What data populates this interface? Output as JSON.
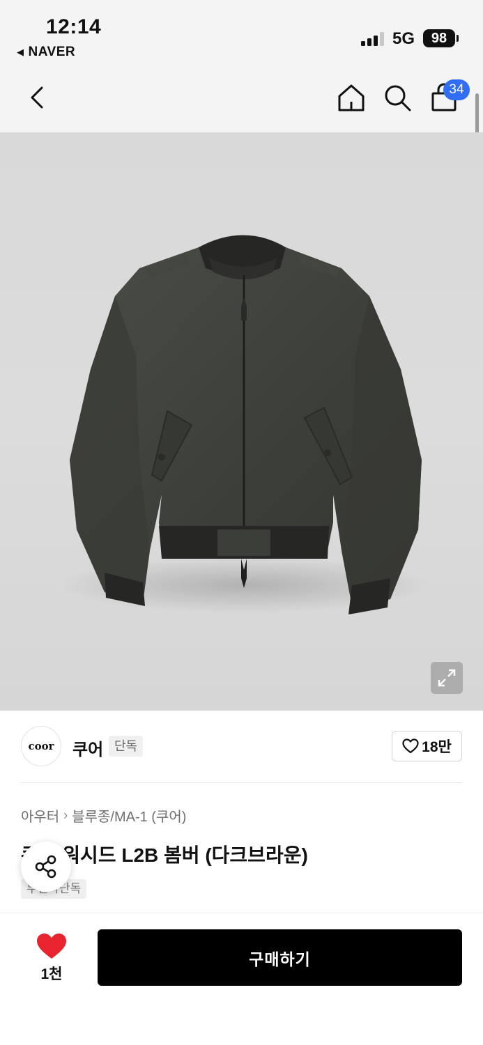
{
  "status_bar": {
    "time": "12:14",
    "back_app": "NAVER",
    "network": "5G",
    "battery": "98"
  },
  "navbar": {
    "cart_count": "34"
  },
  "brand": {
    "logo_text": "coor",
    "name": "쿠어",
    "tag": "단독",
    "likes": "18만"
  },
  "product": {
    "category": "아우터",
    "subcategory": "블루종/MA-1 (쿠어)",
    "title": "쿠어 워시드 L2B 봄버 (다크브라운)",
    "sub_tag": "무신사단독"
  },
  "bottom": {
    "heart_count": "1천",
    "buy_label": "구매하기"
  },
  "colors": {
    "accent_badge": "#2f6ef5",
    "heart": "#e8242e",
    "buy_button": "#000000"
  }
}
